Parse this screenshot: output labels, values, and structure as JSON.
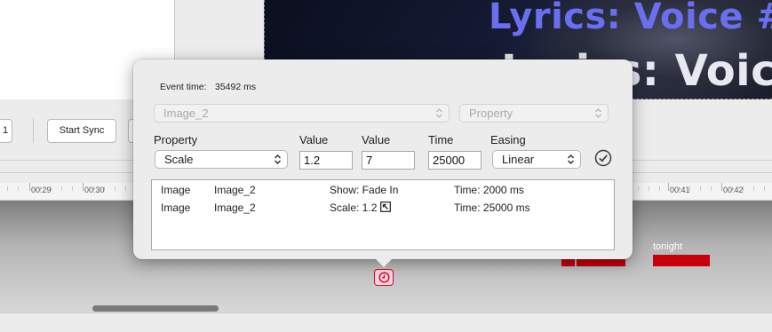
{
  "video_preview": {
    "lyric_line_1": "Lyrics: Voice #",
    "lyric_line_2": "Lyrics: Voice #"
  },
  "toolbar": {
    "stub_label": "1",
    "start_sync_label": "Start Sync"
  },
  "timeline": {
    "ruler_labels": [
      "00:29",
      "00:30",
      "00:41",
      "00:42"
    ],
    "clip_label": "tonight"
  },
  "popover": {
    "event_time_label": "Event time:",
    "event_time_value": "35492 ms",
    "target_select": "Image_2",
    "property_select_placeholder": "Property",
    "columns": {
      "property": "Property",
      "value_start": "Value",
      "value_end": "Value",
      "time": "Time",
      "easing": "Easing"
    },
    "property_value": "Scale",
    "value_start": "1.2",
    "value_end": "7",
    "time": "25000",
    "easing": "Linear",
    "events": [
      {
        "type": "Image",
        "name": "Image_2",
        "action": "Show: Fade In",
        "time": "Time: 2000 ms",
        "icon": null
      },
      {
        "type": "Image",
        "name": "Image_2",
        "action": "Scale: 1.2",
        "time": "Time: 25000 ms",
        "icon": "resize-arrow-icon"
      }
    ]
  },
  "colors": {
    "clip": "#c4000d",
    "marker_border": "#e0002a",
    "lyric_1": "#6a6ff0"
  }
}
